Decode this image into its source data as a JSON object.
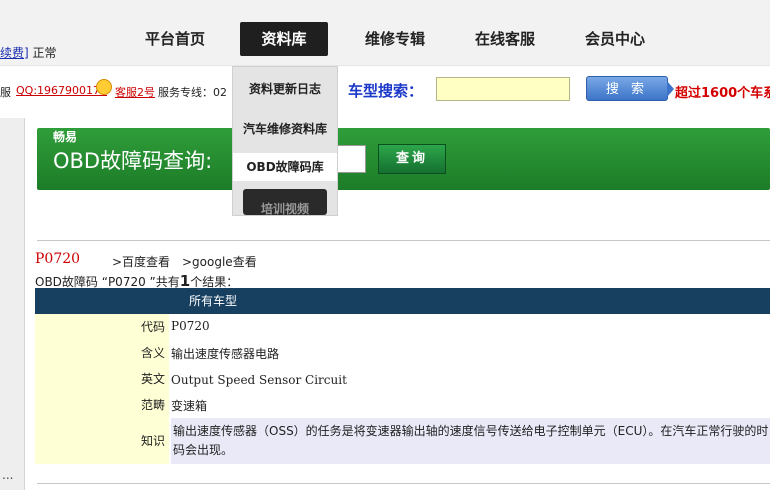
{
  "topbar": {
    "status_link": "续费]",
    "status_text": "正常",
    "nav": [
      "平台首页",
      "资料库",
      "维修专辑",
      "在线客服",
      "会员中心"
    ]
  },
  "contact": {
    "prefix": "服",
    "qq": "QQ:1967900174",
    "kf2": "客服2号",
    "hotline": "服务专线：02"
  },
  "search": {
    "label": "车型搜索：",
    "value": "",
    "button": "搜 索",
    "promo": "超过1600个车系"
  },
  "dropdown": [
    "资料更新日志",
    "汽车维修资料库",
    "OBD故障码库",
    "培训视频"
  ],
  "obd": {
    "brand": "畅易",
    "title": "OBD故障码查询:",
    "input_value": "",
    "button": "查询"
  },
  "result": {
    "code": "P0720",
    "baidu": ">百度查看",
    "google": ">google查看",
    "summary_prefix": "OBD故障码 “P0720 ”共有",
    "summary_count": "1",
    "summary_suffix": "个结果：",
    "header": "所有车型",
    "rows": [
      {
        "label": "代码",
        "value": "P0720"
      },
      {
        "label": "含义",
        "value": "输出速度传感器电路"
      },
      {
        "label": "英文",
        "value": "Output Speed Sensor Circuit"
      },
      {
        "label": "范畴",
        "value": "变速箱"
      },
      {
        "label": "知识",
        "value": "输出速度传感器（OSS）的任务是将变速器输出轴的速度信号传送给电子控制单元（ECU）。在汽车正常行驶的时 码会出现。"
      }
    ]
  },
  "left_strip": "..."
}
